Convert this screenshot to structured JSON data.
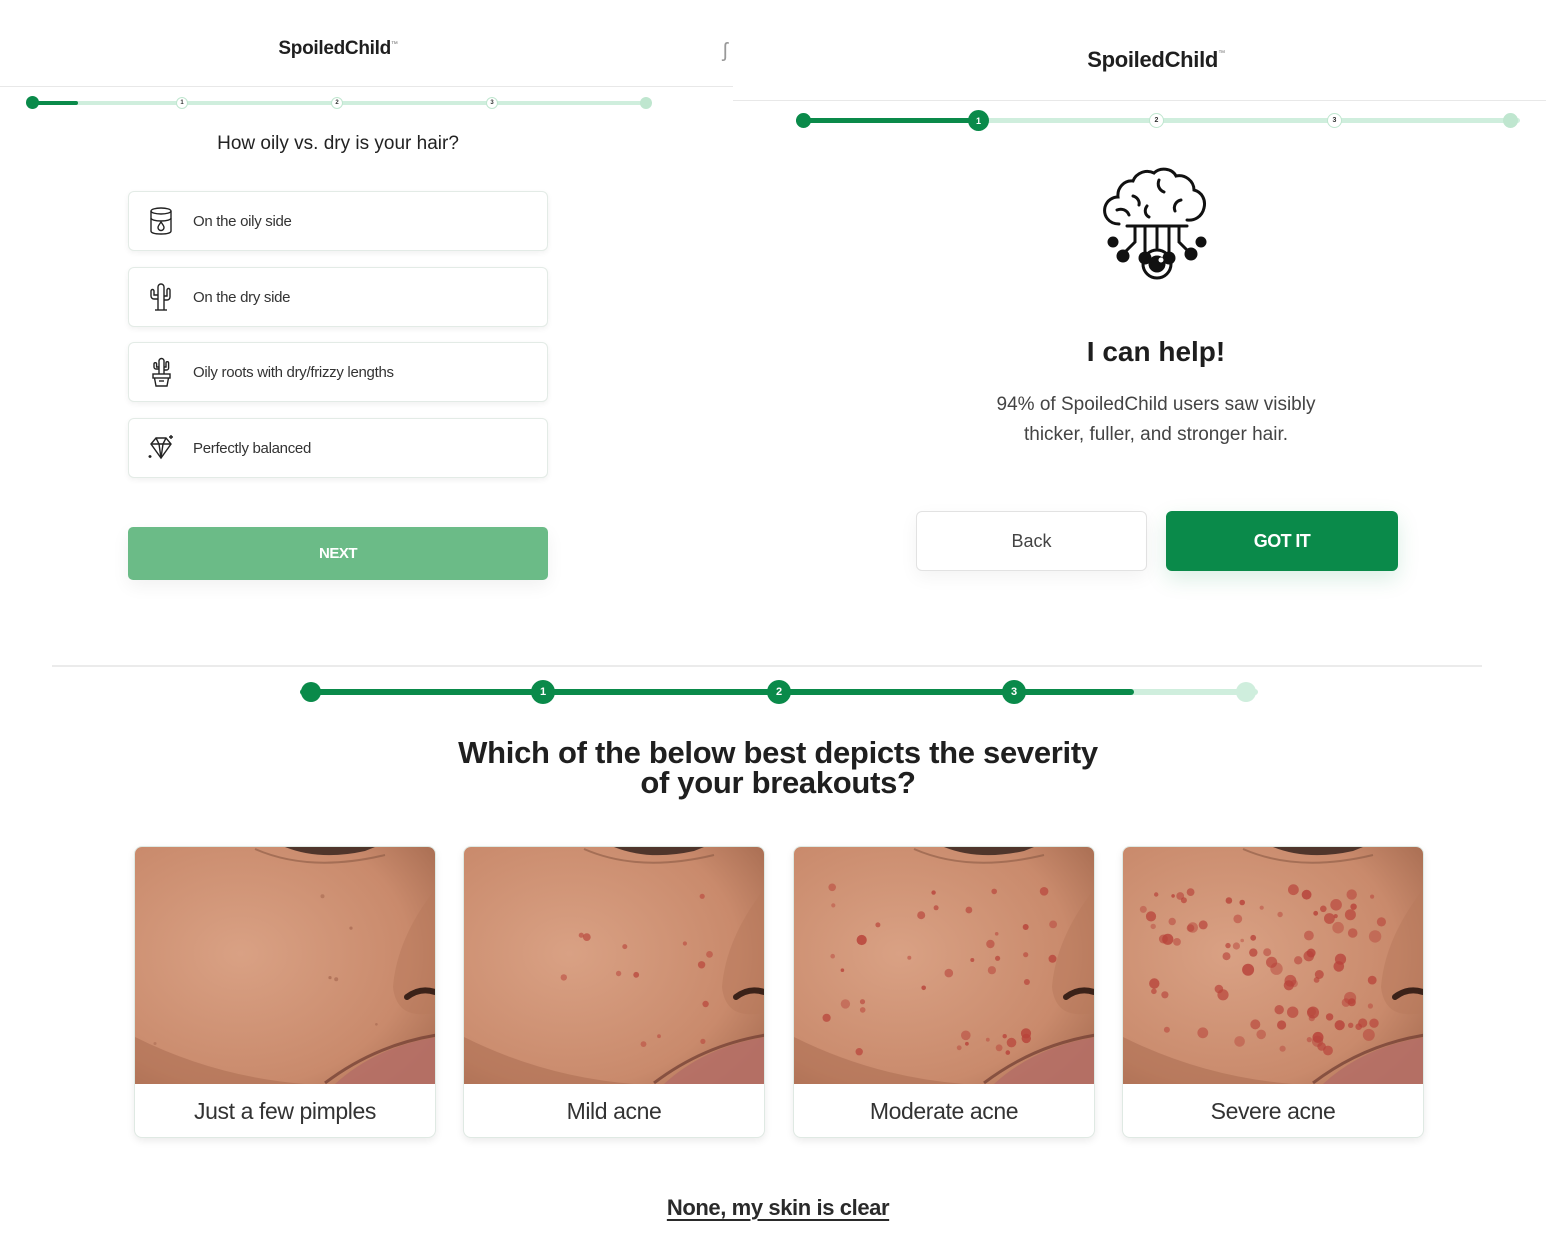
{
  "hair_quiz": {
    "brand": "SpoiledChild",
    "trademark": "™",
    "progress": {
      "fraction": 0.08,
      "steps": [
        "1",
        "2",
        "3"
      ]
    },
    "question": "How oily vs. dry is your hair?",
    "options": [
      {
        "label": "On the oily side",
        "icon": "oil-drop-jar-icon"
      },
      {
        "label": "On the dry side",
        "icon": "cactus-icon"
      },
      {
        "label": "Oily roots with dry/frizzy lengths",
        "icon": "potted-cactus-icon"
      },
      {
        "label": "Perfectly balanced",
        "icon": "diamond-sparkle-icon"
      }
    ],
    "next_label": "NEXT"
  },
  "help_screen": {
    "brand": "SpoiledChild",
    "trademark": "™",
    "progress": {
      "fraction": 0.245,
      "steps": [
        "1",
        "2",
        "3"
      ]
    },
    "icon": "brain-circuit-icon",
    "title": "I can help!",
    "text_line1": "94% of SpoiledChild users saw visibly",
    "text_line2": "thicker, fuller, and stronger hair.",
    "back_label": "Back",
    "gotit_label": "GOT IT"
  },
  "breakouts_quiz": {
    "progress": {
      "fraction": 0.875,
      "steps": [
        "1",
        "2",
        "3"
      ]
    },
    "question_line1": "Which of the below best depicts the severity",
    "question_line2": "of your breakouts?",
    "options": [
      {
        "label": "Just a few pimples",
        "severity": 1
      },
      {
        "label": "Mild acne",
        "severity": 2
      },
      {
        "label": "Moderate acne",
        "severity": 3
      },
      {
        "label": "Severe acne",
        "severity": 4
      }
    ],
    "none_label": "None, my skin is clear"
  },
  "colors": {
    "brand_green": "#0a8a4a",
    "disabled_green": "#6bbb87",
    "track_light": "#cfeedd"
  }
}
